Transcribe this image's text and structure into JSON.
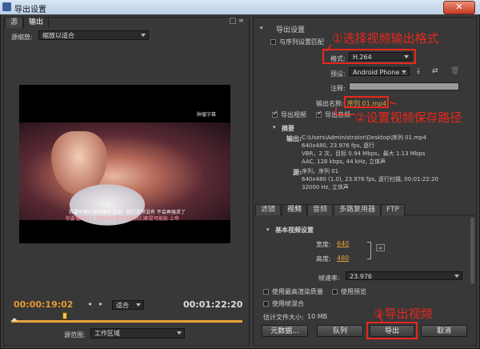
{
  "window": {
    "title": "导出设置",
    "close_glyph": "✕"
  },
  "left": {
    "tabs": [
      "源",
      "输出"
    ],
    "scale_label": "源缩放:",
    "scale_value": "缩放以适合",
    "video_caption_tag": "肿瘤字幕",
    "subtitle_line1": "我要别再打扮你面前流泪，我们是然没有 不会再强求了 ",
    "subtitle_line2": "你要懂你对了 是否时不得不知道我们都是可能能 上帝",
    "timecode_in": "00:00:19:02",
    "timecode_out": "00:01:22:20",
    "fit_value": "适合",
    "range_label": "源范围:",
    "range_value": "工作区域"
  },
  "export": {
    "section_title": "导出设置",
    "match_seq_label": "与序列设置匹配",
    "format_label": "格式:",
    "format_value": "H.264",
    "preset_label": "预设:",
    "preset_value": "Android Phone ...",
    "comment_label": "注释:",
    "output_name_label": "输出名称:",
    "output_name_value": "序列 01.mp4",
    "export_video_label": "导出视频",
    "export_audio_label": "导出音频",
    "summary_title": "摘要",
    "output_key": "输出:",
    "output_lines": [
      "C:\\Users\\Administrator\\Desktop\\序列 01.mp4",
      "640x480, 23.976 fps, 逐行",
      "VBR，2 次，目标 0.94 Mbps，最大 1.13 Mbps",
      "AAC, 128 kbps, 44 kHz, 立体声"
    ],
    "source_key": "源:",
    "source_lines": [
      "序列，序列 01",
      "640x480 (1.0), 23.976 fps, 逐行扫描, 00:01:22:20",
      "32000 Hz, 立体声"
    ]
  },
  "settings_tabs": [
    "滤镜",
    "视频",
    "音频",
    "多路复用器",
    "FTP"
  ],
  "basic_video": {
    "title": "基本视频设置",
    "width_label": "宽度:",
    "width_value": "640",
    "height_label": "高度:",
    "height_value": "480",
    "fps_label": "帧速率:",
    "fps_value": "23.976"
  },
  "bottom": {
    "max_render_label": "使用最高渲染质量",
    "use_preview_label": "使用预览",
    "use_frame_blend_label": "使用帧混合",
    "file_size_label": "估计文件大小:",
    "file_size_value": "10 MB",
    "metadata_button": "元数据...",
    "queue_button": "队列",
    "export_button": "导出",
    "cancel_button": "取消"
  },
  "annotations": {
    "a1": "①选择视频输出格式",
    "a2": "②设置视频保存路径",
    "a3": "③导出视频"
  },
  "colors": {
    "accent_orange": "#e8a23c",
    "annotation_red": "#e8281c",
    "timecode_orange": "#e89a2a"
  }
}
